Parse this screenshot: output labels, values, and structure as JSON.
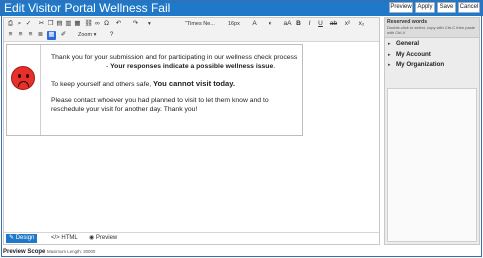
{
  "window": {
    "title": "Edit Visitor Portal Wellness Fail"
  },
  "header_buttons": [
    "Preview",
    "Apply",
    "Save",
    "Cancel"
  ],
  "toolbar": {
    "row1_icons": [
      "print-icon",
      "find-icon",
      "spellcheck-icon",
      "cut-icon",
      "copy-icon",
      "paste-icon",
      "paste-text-icon",
      "paste-word-icon",
      "link-icon",
      "unlink-icon",
      "special-char-icon",
      "undo-icon",
      "redo-icon"
    ],
    "font_name": "\"Times Ne...",
    "font_size": "16px",
    "format_icons": [
      "A",
      "Aa",
      "Aa",
      "B",
      "I",
      "U",
      "ab",
      "x²",
      "x₂"
    ],
    "row2_icons": [
      "align-left-icon",
      "align-center-icon",
      "align-right-icon",
      "align-justify-icon",
      "table-icon",
      "format-painter-icon"
    ],
    "zoom_label": "Zoom",
    "help_symbol": "?"
  },
  "content": {
    "line1": "Thank you for your submission and for participating in our wellness check process",
    "line2_prefix": "- ",
    "line2_bold": "Your responses indicate a possible wellness issue",
    "line2_suffix": ".",
    "line3_prefix": "To keep yourself and others safe, ",
    "line3_bold": "You cannot visit today.",
    "line4": "Please contact whoever you had planned to visit to let them know and to",
    "line5": "reschedule your visit for another day. Thank you!"
  },
  "footer_tabs": [
    {
      "icon": "✎",
      "label": "Design",
      "active": true
    },
    {
      "icon": "</>",
      "label": "HTML",
      "active": false
    },
    {
      "icon": "◉",
      "label": "Preview",
      "active": false
    }
  ],
  "preview_scope": {
    "label": "Preview Scope",
    "note": "Maximum Length: 30000"
  },
  "reserved_words": {
    "title": "Reserved words",
    "hint": "Double-click to select, copy with Ctrl-C then paste with Ctrl-V",
    "items": [
      "General",
      "My Account",
      "My Organization"
    ]
  },
  "colors": {
    "titlebar": "#1f78c8",
    "sad_face": "#e8302a",
    "active_tab": "#1f78c8"
  }
}
